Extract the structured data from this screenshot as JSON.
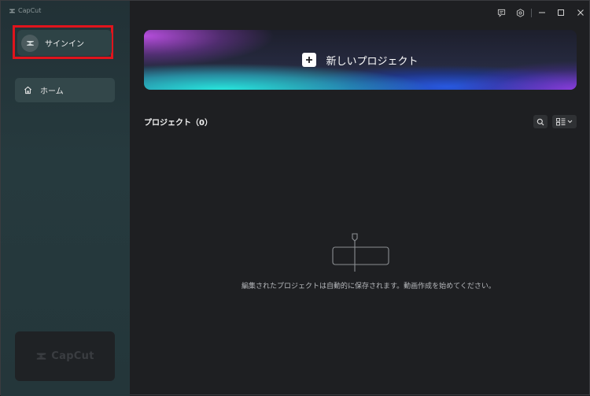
{
  "app": {
    "name": "CapCut"
  },
  "sidebar": {
    "signin_label": "サインイン",
    "nav_items": [
      {
        "label": "ホーム",
        "icon": "home-icon"
      }
    ],
    "promo_logo_text": "CapCut"
  },
  "main": {
    "new_project_label": "新しいプロジェクト",
    "projects_title": "プロジェクト（0）",
    "empty_message": "編集されたプロジェクトは自動的に保存されます。動画作成を始めてください。"
  },
  "colors": {
    "highlight_border": "#e0141c",
    "sidebar_bg": "#263a3e",
    "main_bg": "#1e1f22"
  }
}
